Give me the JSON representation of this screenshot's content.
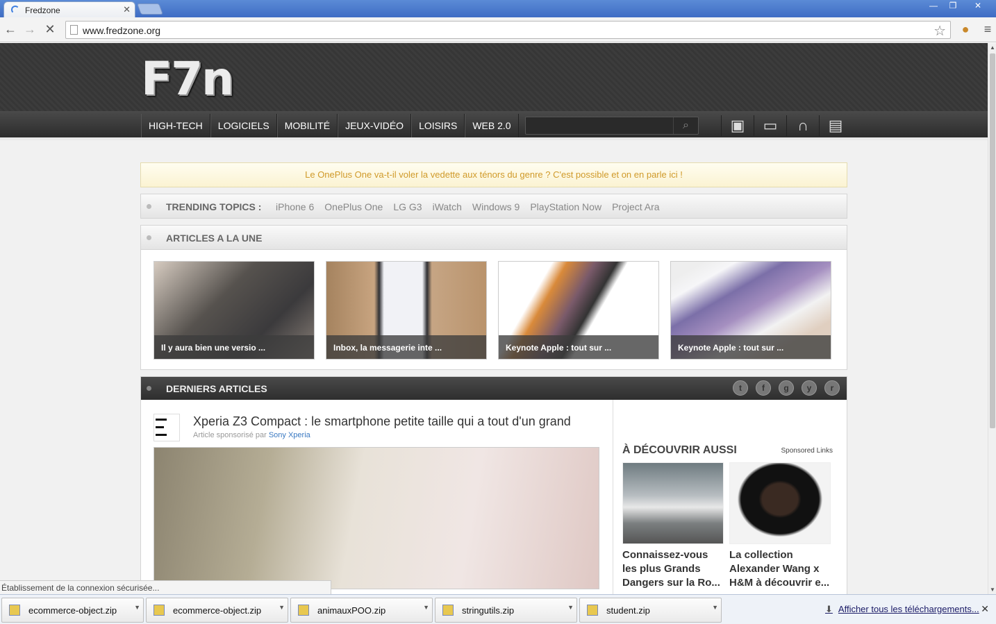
{
  "browser": {
    "tab_title": "Fredzone",
    "url": "www.fredzone.org",
    "window_buttons": [
      "—",
      "❐",
      "✕"
    ]
  },
  "site": {
    "logo_text": "F7n",
    "nav": [
      "HIGH-TECH",
      "LOGICIELS",
      "MOBILITÉ",
      "JEUX-VIDÉO",
      "LOISIRS",
      "WEB 2.0"
    ],
    "search_placeholder": "",
    "nav_icons": [
      "camera-icon",
      "tv-icon",
      "headphones-icon",
      "gamepad-icon"
    ],
    "banner": "Le OnePlus One va-t-il voler la vedette aux ténors du genre ? C'est possible et on en parle ici !",
    "trending": {
      "label": "TRENDING TOPICS :",
      "topics": [
        "iPhone 6",
        "OnePlus One",
        "LG G3",
        "iWatch",
        "Windows 9",
        "PlayStation Now",
        "Project Ara"
      ]
    },
    "une": {
      "label": "ARTICLES A LA UNE",
      "cards": [
        {
          "caption": "Il y aura bien une versio ...",
          "color": "#6e6a64"
        },
        {
          "caption": "Inbox, la messagerie inte ...",
          "color": "#b08d6d"
        },
        {
          "caption": "Keynote Apple : tout sur ...",
          "color": "#f1f1f1"
        },
        {
          "caption": "Keynote Apple : tout sur ...",
          "color": "#e6ddd6"
        }
      ]
    },
    "derniers": {
      "label": "DERNIERS ARTICLES",
      "social": [
        "t",
        "f",
        "g",
        "y",
        "r"
      ],
      "article": {
        "title": "Xperia Z3 Compact : le smartphone petite taille qui a tout d'un grand",
        "sponsor_prefix": "Article sponsorisé par",
        "sponsor": "Sony Xperia"
      },
      "sidebar": {
        "heading": "À DÉCOUVRIR AUSSI",
        "sponsored": "Sponsored Links",
        "items": [
          {
            "title": "Connaissez-vous les plus Grands Dangers sur la Ro..."
          },
          {
            "title": "La collection Alexander Wang x H&M à découvrir e..."
          }
        ]
      }
    }
  },
  "status": "Établissement de la connexion sécurisée...",
  "downloads": {
    "files": [
      "ecommerce-object.zip",
      "ecommerce-object.zip",
      "animauxPOO.zip",
      "stringutils.zip",
      "student.zip"
    ],
    "show_all": "Afficher tous les téléchargements..."
  }
}
